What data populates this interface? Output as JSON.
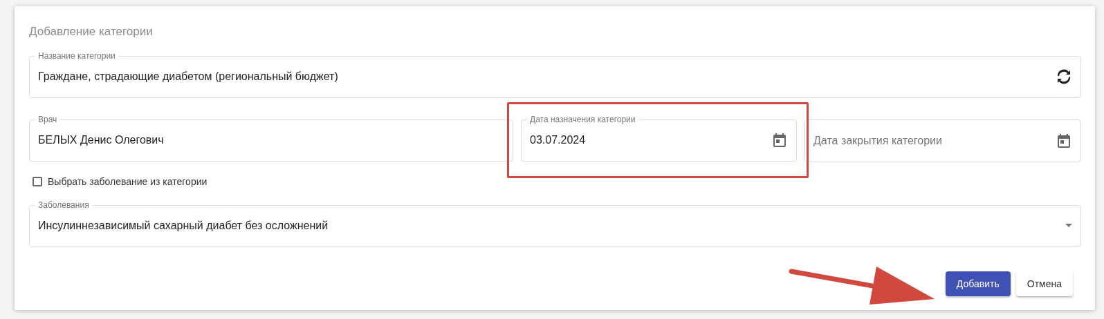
{
  "dialog": {
    "title": "Добавление категории"
  },
  "category_name": {
    "label": "Название категории",
    "value": "Граждане, страдающие диабетом (региональный бюджет)"
  },
  "doctor": {
    "label": "Врач",
    "value": "БЕЛЫХ Денис Олегович"
  },
  "assign_date": {
    "label": "Дата назначения категории",
    "value": "03.07.2024"
  },
  "close_date": {
    "placeholder": "Дата закрытия категории"
  },
  "disease_from_category": {
    "label": "Выбрать заболевание из категории",
    "checked": false
  },
  "diseases": {
    "label": "Заболевания",
    "value": "Инсулиннезависимый сахарный диабет без осложнений"
  },
  "buttons": [
    {
      "label": "Добавить",
      "kind": "primary"
    },
    {
      "label": "Отмена",
      "kind": "secondary"
    }
  ]
}
